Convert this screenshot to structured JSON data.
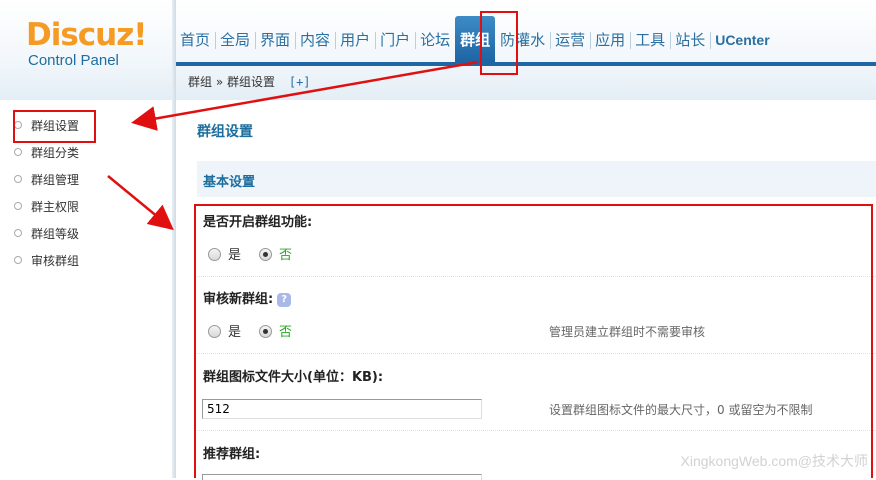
{
  "logo": {
    "word": "Discuz!",
    "subtitle": "Control Panel"
  },
  "topnav": {
    "items": [
      {
        "label": "首页"
      },
      {
        "label": "全局"
      },
      {
        "label": "界面"
      },
      {
        "label": "内容"
      },
      {
        "label": "用户"
      },
      {
        "label": "门户"
      },
      {
        "label": "论坛"
      },
      {
        "label": "群组",
        "active": true
      },
      {
        "label": "防灌水"
      },
      {
        "label": "运营"
      },
      {
        "label": "应用"
      },
      {
        "label": "工具"
      },
      {
        "label": "站长"
      },
      {
        "label": "UCenter"
      }
    ]
  },
  "breadcrumb": {
    "root": "群组",
    "sep": "»",
    "current": "群组设置",
    "add": "[+]"
  },
  "sidebar": {
    "items": [
      {
        "label": "群组设置",
        "active": true
      },
      {
        "label": "群组分类"
      },
      {
        "label": "群组管理"
      },
      {
        "label": "群主权限"
      },
      {
        "label": "群组等级"
      },
      {
        "label": "审核群组"
      }
    ]
  },
  "main": {
    "page_title": "群组设置",
    "section_title": "基本设置",
    "settings": {
      "enable": {
        "label": "是否开启群组功能:",
        "yes": "是",
        "no": "否",
        "selected": "no"
      },
      "review": {
        "label": "审核新群组:",
        "yes": "是",
        "no": "否",
        "selected": "no",
        "hint": "管理员建立群组时不需要审核",
        "help_icon": "?"
      },
      "icon_size": {
        "label": "群组图标文件大小(单位：KB):",
        "value": "512",
        "hint": "设置群组图标文件的最大尺寸，0 或留空为不限制"
      },
      "recommend": {
        "label": "推荐群组:"
      }
    }
  },
  "watermark": "XingkongWeb.com@技术大师",
  "colors": {
    "accent": "#1e66a5",
    "link": "#2a6fa0",
    "annotation": "#e01010",
    "selected_radio_text": "#2aa52a"
  }
}
